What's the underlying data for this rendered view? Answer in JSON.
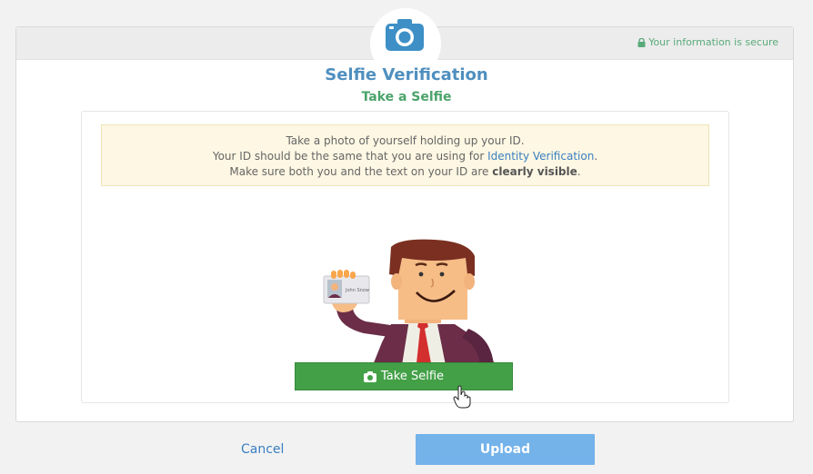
{
  "header": {
    "secure_text": "Your information is secure",
    "camera_icon": "camera-icon",
    "lock_icon": "lock-icon"
  },
  "main": {
    "title": "Selfie Verification",
    "subtitle": "Take a Selfie",
    "notice": {
      "line1": "Take a photo of yourself holding up your ID.",
      "line2_prefix": "Your ID should be the same that you are using for ",
      "line2_link": "Identity Verification",
      "line2_suffix": ".",
      "line3_prefix": "Make sure both you and the text on your ID are ",
      "line3_bold": "clearly visible",
      "line3_suffix": "."
    },
    "id_card_name": "John Snow",
    "take_selfie_label": "Take Selfie"
  },
  "footer": {
    "cancel_label": "Cancel",
    "upload_label": "Upload"
  },
  "colors": {
    "title": "#4f8fbf",
    "subtitle": "#4aa36a",
    "take_button": "#43a047",
    "upload_button": "#74b2ea",
    "camera_icon": "#3d8fc6"
  }
}
